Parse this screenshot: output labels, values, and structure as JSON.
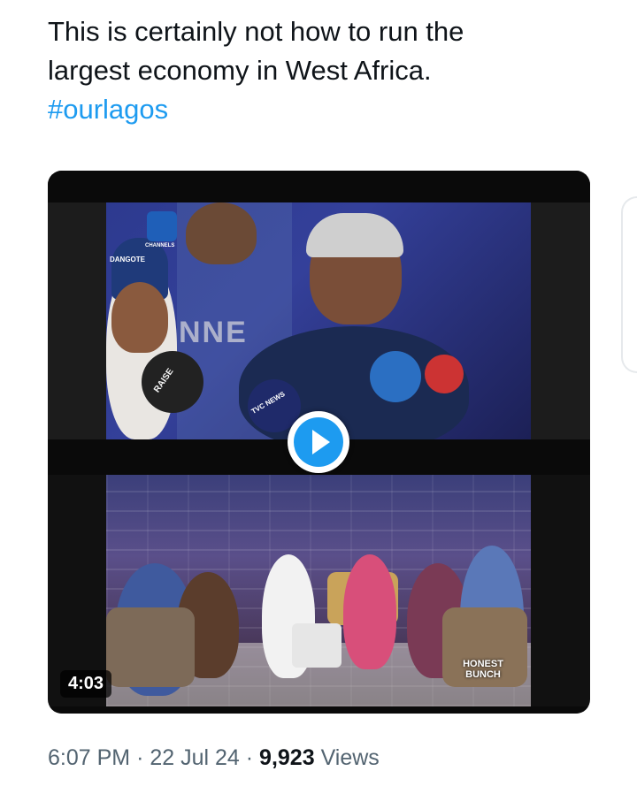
{
  "tweet": {
    "text_lines": [
      "This is certainly not how to run the",
      "largest economy in West Africa."
    ],
    "hashtag": "#ourlagos"
  },
  "video": {
    "duration": "4:03",
    "play_icon": "play-icon",
    "overlay_texts": {
      "channel_badge": "CHANNELS",
      "cap_text": "DANGOTE",
      "backdrop_text": "NNE",
      "mic_raise": "RAISE",
      "mic_tvc": "TVC NEWS",
      "podcast_logo": "HONEST BUNCH"
    }
  },
  "meta": {
    "time": "6:07 PM",
    "separator": "·",
    "date": "22 Jul 24",
    "views_count": "9,923",
    "views_label": "Views"
  },
  "colors": {
    "accent": "#1d9bf0",
    "text": "#0f1419",
    "secondary": "#536471"
  }
}
